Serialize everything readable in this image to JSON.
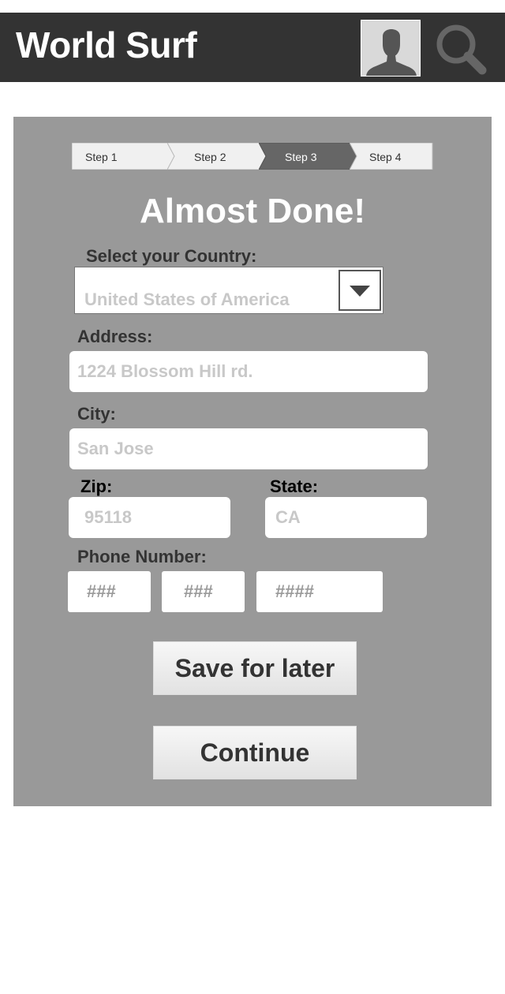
{
  "header": {
    "title": "World Surf",
    "avatar_icon": "user-avatar-icon",
    "search_icon": "search-icon"
  },
  "stepper": {
    "steps": [
      "Step 1",
      "Step 2",
      "Step 3",
      "Step 4"
    ],
    "active_step": 3
  },
  "form": {
    "title": "Almost Done!",
    "country_label": "Select your Country:",
    "country_value": "United States of America",
    "address_label": "Address:",
    "address_value": "1224 Blossom Hill rd.",
    "city_label": "City:",
    "city_value": "San Jose",
    "zip_label": "Zip:",
    "zip_value": "95118",
    "state_label": "State:",
    "state_value": "CA",
    "phone_label": "Phone Number:",
    "phone_area": "###",
    "phone_prefix": "###",
    "phone_line": "####"
  },
  "actions": {
    "save_label": "Save for later",
    "continue_label": "Continue"
  },
  "colors": {
    "header_bg": "#333333",
    "card_bg": "#999999",
    "active_step_bg": "#666666",
    "placeholder_text": "#c8c8c8"
  }
}
